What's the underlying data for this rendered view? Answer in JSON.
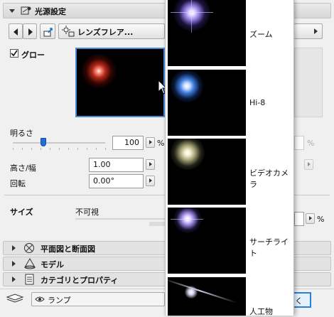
{
  "header": {
    "title": "光源設定"
  },
  "toolbar": {
    "effect_label": "レンズフレア..."
  },
  "glow": {
    "label": "グロー",
    "checked": true
  },
  "brightness": {
    "label": "明るさ",
    "value": "100",
    "unit": "%",
    "slider_value": 0.33
  },
  "height_width": {
    "label": "高さ/幅",
    "value": "1.00"
  },
  "rotation": {
    "label": "回転",
    "value": "0.00°"
  },
  "size": {
    "label": "サイズ",
    "value_label": "不可視",
    "right_unit": "%"
  },
  "sections": [
    {
      "label": "平面図と断面図"
    },
    {
      "label": "モデル"
    },
    {
      "label": "カテゴリとプロパティ"
    }
  ],
  "footer": {
    "layer_label": "ランプ",
    "cancel_fragment": "く"
  },
  "popup": {
    "items": [
      {
        "label": "ズーム"
      },
      {
        "label": "Hi-8"
      },
      {
        "label": "ビデオカメラ"
      },
      {
        "label": "サーチライト"
      },
      {
        "label": "人工物"
      }
    ]
  },
  "colors": {
    "preview_glow": "#d23a2a",
    "zoom_glow": "#b8a8ff",
    "hi8_glow": "#6fa8ff",
    "video_glow": "#e8e2b0",
    "search_glow": "#c8b8ff"
  }
}
